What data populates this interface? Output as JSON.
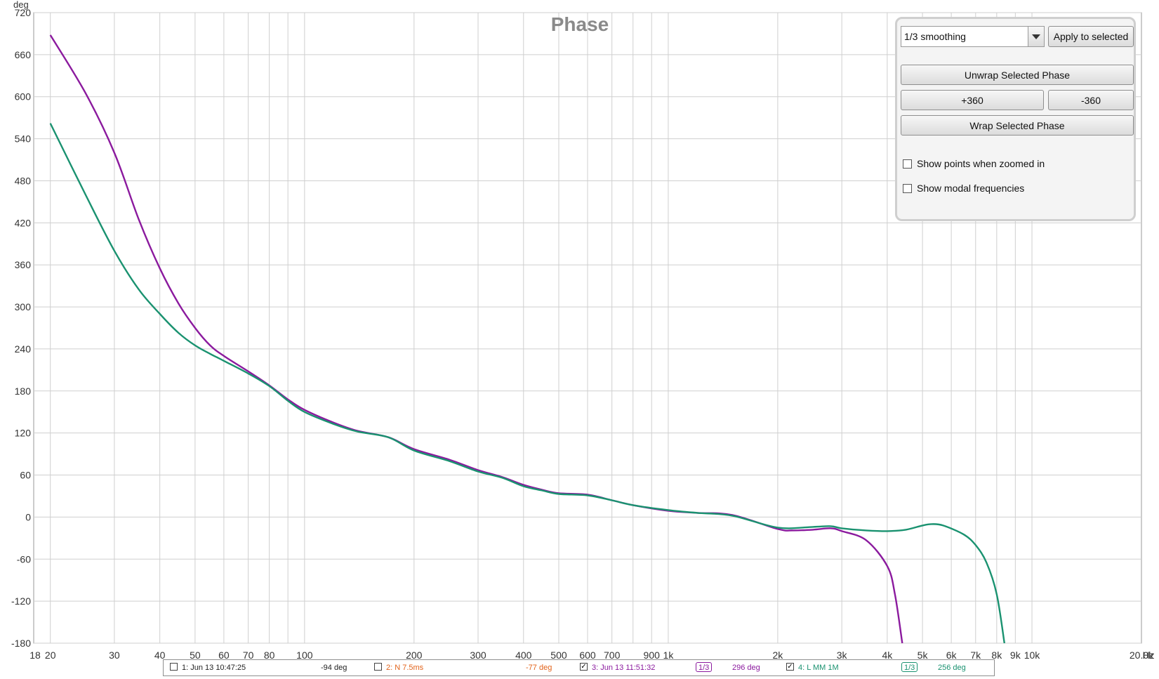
{
  "chart_data": {
    "type": "line",
    "title": "Phase",
    "ylabel": "deg",
    "xunit": "Hz",
    "x_scale": "log",
    "xlim": [
      18,
      20000
    ],
    "ylim": [
      -180,
      720
    ],
    "yticks": [
      720,
      660,
      600,
      540,
      480,
      420,
      360,
      300,
      240,
      180,
      120,
      60,
      0,
      -60,
      -120,
      -180
    ],
    "xticks": [
      {
        "v": 18,
        "label": "18"
      },
      {
        "v": 20,
        "label": "20"
      },
      {
        "v": 30,
        "label": "30"
      },
      {
        "v": 40,
        "label": "40"
      },
      {
        "v": 50,
        "label": "50"
      },
      {
        "v": 60,
        "label": "60"
      },
      {
        "v": 70,
        "label": "70"
      },
      {
        "v": 80,
        "label": "80"
      },
      {
        "v": 100,
        "label": "100"
      },
      {
        "v": 200,
        "label": "200"
      },
      {
        "v": 300,
        "label": "300"
      },
      {
        "v": 400,
        "label": "400"
      },
      {
        "v": 500,
        "label": "500"
      },
      {
        "v": 600,
        "label": "600"
      },
      {
        "v": 700,
        "label": "700"
      },
      {
        "v": 900,
        "label": "900"
      },
      {
        "v": 1000,
        "label": "1k"
      },
      {
        "v": 2000,
        "label": "2k"
      },
      {
        "v": 3000,
        "label": "3k"
      },
      {
        "v": 4000,
        "label": "4k"
      },
      {
        "v": 5000,
        "label": "5k"
      },
      {
        "v": 6000,
        "label": "6k"
      },
      {
        "v": 7000,
        "label": "7k"
      },
      {
        "v": 8000,
        "label": "8k"
      },
      {
        "v": 9000,
        "label": "9k"
      },
      {
        "v": 10000,
        "label": "10k"
      },
      {
        "v": 20000,
        "label": "20.0k"
      }
    ],
    "grid": true,
    "series": [
      {
        "color": "#8b1a9e",
        "points": [
          [
            20,
            688
          ],
          [
            25,
            605
          ],
          [
            30,
            520
          ],
          [
            35,
            425
          ],
          [
            40,
            355
          ],
          [
            45,
            305
          ],
          [
            50,
            270
          ],
          [
            55,
            245
          ],
          [
            60,
            230
          ],
          [
            70,
            208
          ],
          [
            80,
            188
          ],
          [
            90,
            168
          ],
          [
            100,
            153
          ],
          [
            120,
            135
          ],
          [
            140,
            123
          ],
          [
            170,
            114
          ],
          [
            200,
            97
          ],
          [
            250,
            82
          ],
          [
            300,
            67
          ],
          [
            350,
            57
          ],
          [
            400,
            46
          ],
          [
            450,
            39
          ],
          [
            500,
            34
          ],
          [
            600,
            32
          ],
          [
            700,
            24
          ],
          [
            800,
            17
          ],
          [
            1000,
            9
          ],
          [
            1200,
            6
          ],
          [
            1500,
            3
          ],
          [
            2000,
            -17
          ],
          [
            2200,
            -19
          ],
          [
            2500,
            -18
          ],
          [
            2800,
            -16
          ],
          [
            3000,
            -20
          ],
          [
            3500,
            -33
          ],
          [
            4000,
            -70
          ],
          [
            4200,
            -110
          ],
          [
            4400,
            -182
          ]
        ]
      },
      {
        "color": "#1a9270",
        "points": [
          [
            20,
            562
          ],
          [
            25,
            460
          ],
          [
            30,
            380
          ],
          [
            35,
            325
          ],
          [
            40,
            290
          ],
          [
            45,
            263
          ],
          [
            50,
            245
          ],
          [
            55,
            233
          ],
          [
            60,
            223
          ],
          [
            70,
            205
          ],
          [
            80,
            187
          ],
          [
            90,
            166
          ],
          [
            100,
            150
          ],
          [
            120,
            133
          ],
          [
            140,
            122
          ],
          [
            170,
            114
          ],
          [
            200,
            95
          ],
          [
            250,
            80
          ],
          [
            300,
            65
          ],
          [
            350,
            56
          ],
          [
            400,
            44
          ],
          [
            450,
            38
          ],
          [
            500,
            33
          ],
          [
            600,
            31
          ],
          [
            700,
            24
          ],
          [
            800,
            17
          ],
          [
            1000,
            10
          ],
          [
            1200,
            6
          ],
          [
            1500,
            2
          ],
          [
            2000,
            -15
          ],
          [
            2500,
            -14
          ],
          [
            2800,
            -13
          ],
          [
            3000,
            -16
          ],
          [
            3500,
            -19
          ],
          [
            4000,
            -20
          ],
          [
            4500,
            -18
          ],
          [
            5000,
            -12
          ],
          [
            5300,
            -10
          ],
          [
            5700,
            -12
          ],
          [
            6500,
            -25
          ],
          [
            7000,
            -40
          ],
          [
            7500,
            -65
          ],
          [
            8000,
            -110
          ],
          [
            8400,
            -182
          ]
        ]
      }
    ]
  },
  "panel": {
    "smoothing_value": "1/3 smoothing",
    "apply_label": "Apply to selected",
    "unwrap_label": "Unwrap Selected Phase",
    "plus360_label": "+360",
    "minus360_label": "-360",
    "wrap_label": "Wrap Selected Phase",
    "show_points_label": "Show points when zoomed in",
    "show_modal_label": "Show modal frequencies"
  },
  "legend": {
    "m1_label": "1: Jun 13 10:47:25",
    "m1_value": "-94 deg",
    "m2_label": "2: N 7.5ms",
    "m2_value": "-77 deg",
    "m3_label": "3: Jun 13 11:51:32",
    "m3_smoothing": "1/3",
    "m3_value": "296 deg",
    "m4_label": "4: L MM 1M",
    "m4_smoothing": "1/3",
    "m4_value": "256 deg",
    "m1_color": "#222222",
    "m2_color": "#e2631b",
    "m3_color": "#8b1a9e",
    "m4_color": "#1a9270"
  }
}
